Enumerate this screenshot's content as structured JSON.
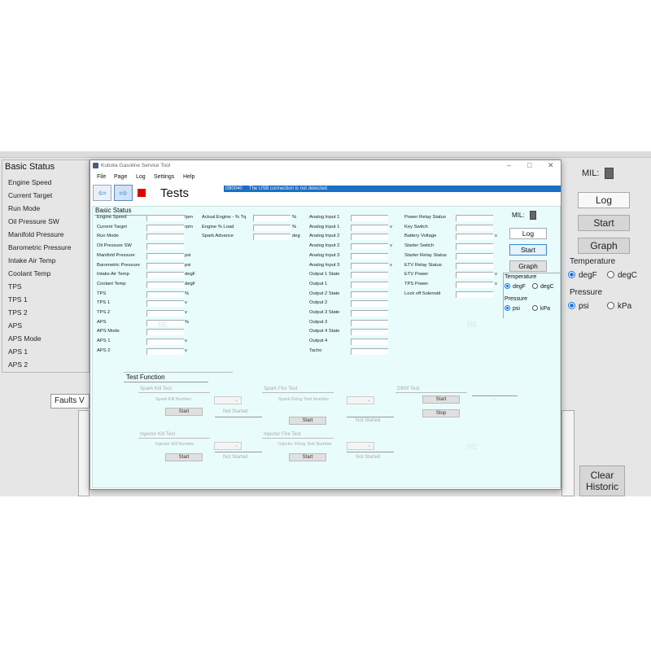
{
  "background_app": {
    "group_title": "Basic Status",
    "labels": [
      "Engine Speed",
      "Current Target",
      "Run Mode",
      "Oil Pressure SW",
      "Manifold Pressure",
      "Barometric Pressure",
      "Intake Air Temp",
      "Coolant Temp",
      "TPS",
      "TPS 1",
      "TPS 2",
      "APS",
      "APS Mode",
      "APS 1",
      "APS 2"
    ],
    "faults_label": "Faults V",
    "mil_label": "MIL:",
    "log_label": "Log",
    "start_label": "Start",
    "graph_label": "Graph",
    "temperature_label": "Temperature",
    "degf_label": "degF",
    "degc_label": "degC",
    "pressure_label": "Pressure",
    "psi_label": "psi",
    "kpa_label": "kPa",
    "clear_historic_line1": "Clear",
    "clear_historic_line2": "Historic"
  },
  "window": {
    "title": "Kubota Gasoline Service Tool",
    "menu": [
      "File",
      "Page",
      "Log",
      "Settings",
      "Help"
    ],
    "page_title": "Tests",
    "status_code": "0B0040",
    "status_message": "The USB connection is not detected.",
    "basic_status_title": "Basic Status",
    "col1": [
      {
        "label": "Engine Speed",
        "unit": "rpm"
      },
      {
        "label": "Current Target",
        "unit": "rpm"
      },
      {
        "label": "Run Mode",
        "unit": ""
      },
      {
        "label": "Oil Pressure SW",
        "unit": ""
      },
      {
        "label": "Manifold Pressure",
        "unit": "psi"
      },
      {
        "label": "Barometric Pressure",
        "unit": "psi"
      },
      {
        "label": "Intake Air Temp",
        "unit": "degF"
      },
      {
        "label": "Coolant Temp",
        "unit": "degF"
      },
      {
        "label": "TPS",
        "unit": "%"
      },
      {
        "label": "TPS 1",
        "unit": "v"
      },
      {
        "label": "TPS 2",
        "unit": "v"
      },
      {
        "label": "APS",
        "unit": "%"
      },
      {
        "label": "APS Mode",
        "unit": ""
      },
      {
        "label": "APS 1",
        "unit": "v"
      },
      {
        "label": "APS 2",
        "unit": "v"
      }
    ],
    "col2": [
      {
        "label": "Actual Engine - % Tq",
        "unit": "%"
      },
      {
        "label": "Engine % Load",
        "unit": "%"
      },
      {
        "label": "Spark Advance",
        "unit": "deg"
      }
    ],
    "col3": [
      {
        "label": "Analog Input 1",
        "unit": ""
      },
      {
        "label": "Analog Input 1",
        "unit": "v"
      },
      {
        "label": "Analog Input 2",
        "unit": ""
      },
      {
        "label": "Analog Input 2",
        "unit": "v"
      },
      {
        "label": "Analog Input 3",
        "unit": ""
      },
      {
        "label": "Analog Input 3",
        "unit": "v"
      },
      {
        "label": "Output 1 State",
        "unit": ""
      },
      {
        "label": "Output 1",
        "unit": ""
      },
      {
        "label": "Output 2 State",
        "unit": ""
      },
      {
        "label": "Output 2",
        "unit": ""
      },
      {
        "label": "Output 3 State",
        "unit": ""
      },
      {
        "label": "Output 3",
        "unit": ""
      },
      {
        "label": "Output 4 State",
        "unit": ""
      },
      {
        "label": "Output 4",
        "unit": ""
      },
      {
        "label": "Tacho",
        "unit": ""
      }
    ],
    "col4": [
      {
        "label": "Power Relay Status",
        "unit": ""
      },
      {
        "label": "Key Switch",
        "unit": ""
      },
      {
        "label": "Battery Voltage",
        "unit": "v"
      },
      {
        "label": "Starter Switch",
        "unit": ""
      },
      {
        "label": "Starter Relay Status",
        "unit": ""
      },
      {
        "label": "ETV Relay Status",
        "unit": ""
      },
      {
        "label": "ETV Power",
        "unit": "v"
      },
      {
        "label": "TPS Power",
        "unit": "v"
      },
      {
        "label": "Lock off Solenoid",
        "unit": ""
      }
    ],
    "side": {
      "mil_label": "MIL:",
      "log_label": "Log",
      "start_label": "Start",
      "graph_label": "Graph",
      "temperature_label": "Temperature",
      "degf_label": "degF",
      "degc_label": "degC",
      "pressure_label": "Pressure",
      "psi_label": "psi",
      "kpa_label": "kPa"
    },
    "test_function": {
      "title": "Test Function",
      "spark_kill": {
        "title": "Spark Kill Test",
        "number_label": "Spark Kill Number",
        "start": "Start",
        "status": "Not Started"
      },
      "spark_fire": {
        "title": "Spark Fire Test",
        "number_label": "Spark Firing Test Number",
        "start": "Start",
        "status": "Not Started"
      },
      "dbw": {
        "title": "DBW Test",
        "start": "Start",
        "stop": "Stop",
        "value": "-"
      },
      "injector_kill": {
        "title": "Injector Kill Test",
        "number_label": "Injector Kill Number",
        "start": "Start",
        "status": "Not Started"
      },
      "injector_fire": {
        "title": "Injector Fire Test",
        "number_label": "Injector Firing Test Number",
        "start": "Start",
        "status": "Not Started"
      }
    },
    "watermark": "RE"
  },
  "colors": {
    "status_bar": "#1a6fc4",
    "panel": "#e9fcfc",
    "stop": "#e00000",
    "radio_selected": "#1a73e8"
  }
}
